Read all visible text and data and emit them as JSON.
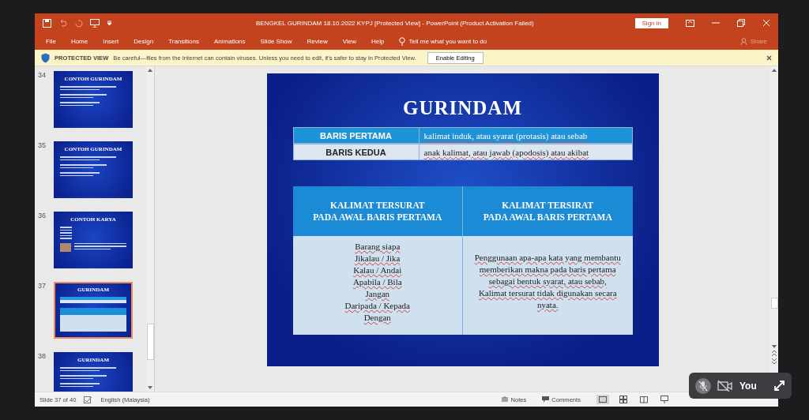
{
  "window": {
    "title": "BENGKEL GURINDAM 18.10.2022 KYPJ [Protected View]  -  PowerPoint (Product Activation Failed)",
    "sign_in": "Sign in"
  },
  "ribbon": {
    "tabs": [
      "File",
      "Home",
      "Insert",
      "Design",
      "Transitions",
      "Animations",
      "Slide Show",
      "Review",
      "View",
      "Help"
    ],
    "tell_me": "Tell me what you want to do",
    "share": "Share"
  },
  "protected_view": {
    "label": "PROTECTED VIEW",
    "message": "Be careful—files from the Internet can contain viruses. Unless you need to edit, it's safer to stay in Protected View.",
    "button": "Enable Editing"
  },
  "thumbnails": [
    {
      "number": "34",
      "title": "CONTOH GURINDAM",
      "kind": "text",
      "selected": false
    },
    {
      "number": "35",
      "title": "CONTOH GURINDAM",
      "kind": "text",
      "selected": false
    },
    {
      "number": "36",
      "title": "CONTOH KARYA",
      "kind": "photo",
      "selected": false
    },
    {
      "number": "37",
      "title": "GURINDAM",
      "kind": "table",
      "selected": true
    },
    {
      "number": "38",
      "title": "GURINDAM",
      "kind": "text",
      "selected": false
    }
  ],
  "slide": {
    "title": "GURINDAM",
    "lines": [
      {
        "label": "BARIS PERTAMA",
        "text": "kalimat induk, atau syarat (protasis) atau sebab"
      },
      {
        "label": "BARIS KEDUA",
        "text": "anak kalimat, atau jawab (apodosis) atau akibat"
      }
    ],
    "columns": [
      {
        "heading": [
          "KALIMAT TERSURAT",
          "PADA AWAL BARIS PERTAMA"
        ],
        "body": [
          "Barang siapa",
          "Jikalau / Jika",
          "Kalau / Andai",
          "Apabila / Bila",
          "Jangan",
          "Daripada / Kepada",
          "Dengan"
        ]
      },
      {
        "heading": [
          "KALIMAT TERSIRAT",
          "PADA AWAL BARIS PERTAMA"
        ],
        "body": [
          "Penggunaan apa-apa kata yang membantu",
          "memberikan makna pada baris pertama",
          "sebagai bentuk syarat, atau sebab,",
          "Kalimat tersurat tidak digunakan secara",
          "nyata."
        ]
      }
    ]
  },
  "status_bar": {
    "slide": "Slide 37 of 40",
    "language": "English (Malaysia)",
    "notes": "Notes",
    "comments": "Comments"
  },
  "call_overlay": {
    "name": "You",
    "mic_muted": true,
    "camera_off": true
  }
}
